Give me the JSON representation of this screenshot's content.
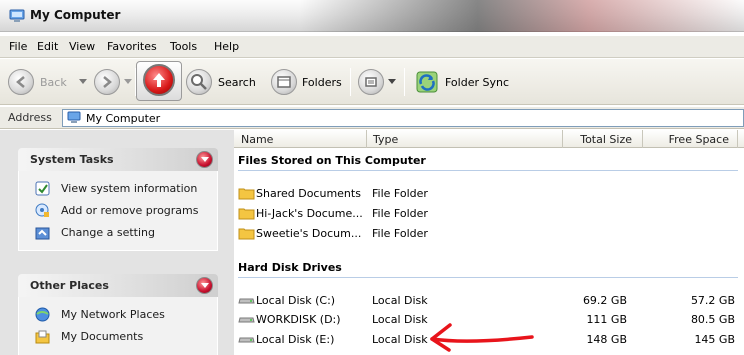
{
  "window": {
    "title": "My Computer"
  },
  "menu": [
    "File",
    "Edit",
    "View",
    "Favorites",
    "Tools",
    "Help"
  ],
  "toolbar": {
    "back": "Back",
    "search": "Search",
    "folders": "Folders",
    "sync": "Folder Sync"
  },
  "address": {
    "label": "Address",
    "value": "My Computer"
  },
  "system_tasks": {
    "title": "System Tasks",
    "items": [
      {
        "label": "View system information",
        "icon": "system-info-icon"
      },
      {
        "label": "Add or remove programs",
        "icon": "programs-icon"
      },
      {
        "label": "Change a setting",
        "icon": "control-panel-icon"
      }
    ]
  },
  "other_places": {
    "title": "Other Places",
    "items": [
      {
        "label": "My Network Places",
        "icon": "network-icon"
      },
      {
        "label": "My Documents",
        "icon": "documents-icon"
      }
    ]
  },
  "columns": {
    "name": "Name",
    "type": "Type",
    "total": "Total Size",
    "free": "Free Space"
  },
  "groups": {
    "files": {
      "title": "Files Stored on This Computer",
      "rows": [
        {
          "name": "Shared Documents",
          "type": "File Folder"
        },
        {
          "name": "Hi-Jack's Docume...",
          "type": "File Folder"
        },
        {
          "name": "Sweetie's Docum...",
          "type": "File Folder"
        }
      ]
    },
    "drives": {
      "title": "Hard Disk Drives",
      "rows": [
        {
          "name": "Local Disk (C:)",
          "type": "Local Disk",
          "total": "69.2 GB",
          "free": "57.2 GB"
        },
        {
          "name": "WORKDISK (D:)",
          "type": "Local Disk",
          "total": "111 GB",
          "free": "80.5 GB"
        },
        {
          "name": "Local Disk (E:)",
          "type": "Local Disk",
          "total": "148 GB",
          "free": "145 GB"
        }
      ]
    }
  },
  "colors": {
    "annotation_arrow": "#e8141b",
    "collapse_button": "#c8102e",
    "folder": "#f4c542"
  }
}
